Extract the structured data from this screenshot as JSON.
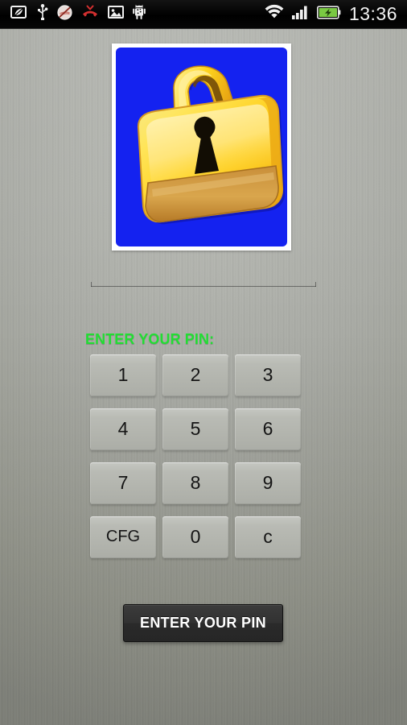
{
  "status_bar": {
    "time": "13:36",
    "left_icons": [
      {
        "name": "power-saver-leaf-icon",
        "glyph": "leaf"
      },
      {
        "name": "usb-icon",
        "glyph": "usb"
      },
      {
        "name": "silent-mode-icon",
        "glyph": "no-sound"
      },
      {
        "name": "missed-call-icon",
        "glyph": "phone-missed"
      },
      {
        "name": "screenshot-image-icon",
        "glyph": "picture"
      },
      {
        "name": "android-system-update-icon",
        "glyph": "android"
      }
    ],
    "right_icons": [
      {
        "name": "wifi-icon",
        "glyph": "wifi"
      },
      {
        "name": "cellular-signal-icon",
        "glyph": "signal-bars"
      },
      {
        "name": "battery-charging-icon",
        "glyph": "battery-charging"
      }
    ],
    "colors": {
      "background": "#000000",
      "text": "#f2f2f2",
      "battery": "#7ac943"
    }
  },
  "app": {
    "lock_image": {
      "name": "padlock-image",
      "background_color": "#1422f0",
      "frame_color": "#ffffff",
      "lock_body_color": "#ffd21e",
      "lock_highlight_color": "#ffe87a",
      "lock_shadow_color": "#d79a22",
      "keyhole_color": "#000000"
    },
    "pin_field": {
      "name": "pin-input",
      "value": "",
      "placeholder": ""
    },
    "pin_label": "ENTER YOUR PIN:",
    "pin_label_color": "#22dd33",
    "keypad": [
      {
        "label": "1",
        "name": "key-1"
      },
      {
        "label": "2",
        "name": "key-2"
      },
      {
        "label": "3",
        "name": "key-3"
      },
      {
        "label": "4",
        "name": "key-4"
      },
      {
        "label": "5",
        "name": "key-5"
      },
      {
        "label": "6",
        "name": "key-6"
      },
      {
        "label": "7",
        "name": "key-7"
      },
      {
        "label": "8",
        "name": "key-8"
      },
      {
        "label": "9",
        "name": "key-9"
      },
      {
        "label": "CFG",
        "name": "key-cfg"
      },
      {
        "label": "0",
        "name": "key-0"
      },
      {
        "label": "c",
        "name": "key-clear"
      }
    ],
    "submit_label": "ENTER YOUR PIN",
    "background_color": "#a3a59e"
  }
}
